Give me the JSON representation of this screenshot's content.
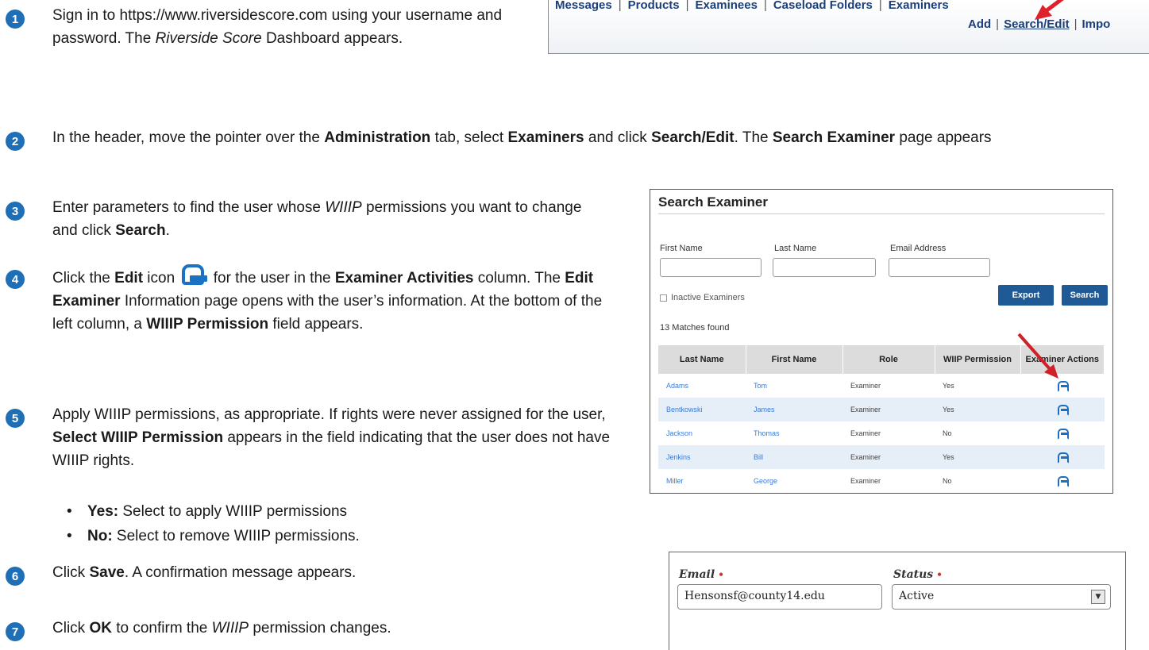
{
  "nav": {
    "items": [
      "Messages",
      "Products",
      "Examinees",
      "Caseload Folders",
      "Examiners"
    ],
    "sub_items": [
      "Add",
      "Search/Edit",
      "Impo"
    ],
    "arrow_color": "#e0202a"
  },
  "steps": [
    {
      "num": "1",
      "parts": [
        {
          "t": "Sign in to https://www.riversidescore.com using your username and password. The "
        },
        {
          "t": "Riverside Score",
          "i": true
        },
        {
          "t": " Dashboard appears."
        }
      ]
    },
    {
      "num": "2",
      "parts": [
        {
          "t": "In the header, move the pointer over the "
        },
        {
          "t": "Administration",
          "b": true
        },
        {
          "t": " tab, select "
        },
        {
          "t": "Examiners",
          "b": true
        },
        {
          "t": " and click "
        },
        {
          "t": "Search/Edit",
          "b": true
        },
        {
          "t": ". The "
        },
        {
          "t": "Search Examiner",
          "b": true
        },
        {
          "t": " page appears"
        }
      ]
    },
    {
      "num": "3",
      "parts": [
        {
          "t": "Enter parameters to find the user whose "
        },
        {
          "t": "WIIIP",
          "i": true
        },
        {
          "t": " permissions you want to change and click "
        },
        {
          "t": "Search",
          "b": true
        },
        {
          "t": "."
        }
      ]
    },
    {
      "num": "4",
      "parts": [
        {
          "t": "Click the "
        },
        {
          "t": "Edit",
          "b": true
        },
        {
          "t": " icon "
        },
        {
          "icon": "edit-icon"
        },
        {
          "t": " for the user in the "
        },
        {
          "t": "Examiner Activities",
          "b": true
        },
        {
          "t": " column. The "
        },
        {
          "t": "Edit Examiner",
          "b": true
        },
        {
          "t": " Information page opens with the user’s information. At the bottom of the left column, a "
        },
        {
          "t": "WIIIP Permission",
          "b": true
        },
        {
          "t": " field appears."
        }
      ]
    },
    {
      "num": "5",
      "parts": [
        {
          "t": "Apply WIIIP permissions, as appropriate. If rights were never assigned for the user, "
        },
        {
          "t": "Select WIIIP Permission",
          "b": true
        },
        {
          "t": " appears in the field indicating that the user does not have WIIIP rights."
        }
      ]
    },
    {
      "num": "6",
      "parts": [
        {
          "t": "Click "
        },
        {
          "t": "Save",
          "b": true
        },
        {
          "t": ". A confirmation message appears."
        }
      ]
    },
    {
      "num": "7",
      "parts": [
        {
          "t": "Click "
        },
        {
          "t": "OK",
          "b": true
        },
        {
          "t": " to confirm the "
        },
        {
          "t": "WIIIP",
          "i": true
        },
        {
          "t": " permission changes."
        }
      ]
    }
  ],
  "bullets": [
    {
      "label": "Yes:",
      "text": " Select to apply WIIIP permissions"
    },
    {
      "label": "No:",
      "text": " Select to remove WIIIP permissions."
    }
  ],
  "search_examiner": {
    "title": "Search Examiner",
    "labels": {
      "first_name": "First Name",
      "last_name": "Last Name",
      "email": "Email Address"
    },
    "inactive_label": "Inactive Examiners",
    "export_label": "Export",
    "search_label": "Search",
    "matches": "13 Matches found",
    "columns": [
      "Last Name",
      "First Name",
      "Role",
      "WIIP Permission",
      "Examiner Actions"
    ],
    "rows": [
      [
        "Adams",
        "Tom",
        "Examiner",
        "Yes"
      ],
      [
        "Bentkowski",
        "James",
        "Examiner",
        "Yes"
      ],
      [
        "Jackson",
        "Thomas",
        "Examiner",
        "No"
      ],
      [
        "Jenkins",
        "Bill",
        "Examiner",
        "Yes"
      ],
      [
        "Miller",
        "George",
        "Examiner",
        "No"
      ]
    ]
  },
  "edit_form": {
    "email_label": "Email",
    "email_value": "Hensonsf@county14.edu",
    "status_label": "Status",
    "status_value": "Active",
    "required_marker": "•"
  }
}
